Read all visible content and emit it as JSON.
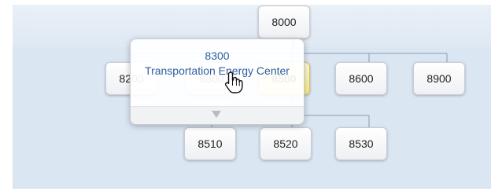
{
  "org_chart": {
    "root": {
      "label": "8000"
    },
    "row2": [
      {
        "label": "8200"
      },
      {
        "label": "8300"
      },
      {
        "label": "8500"
      },
      {
        "label": "8600"
      },
      {
        "label": "8900"
      }
    ],
    "row3": [
      {
        "label": "8510"
      },
      {
        "label": "8520"
      },
      {
        "label": "8530"
      }
    ]
  },
  "popup": {
    "code": "8300",
    "name": "Transportation Energy Center"
  },
  "icons": {
    "expand": "triangle-down-icon",
    "cursor": "hand-pointer-icon"
  },
  "colors": {
    "canvas_bg": "#dbe6f3",
    "active_node": "#f7e98a",
    "popup_text": "#2f5f9e"
  }
}
